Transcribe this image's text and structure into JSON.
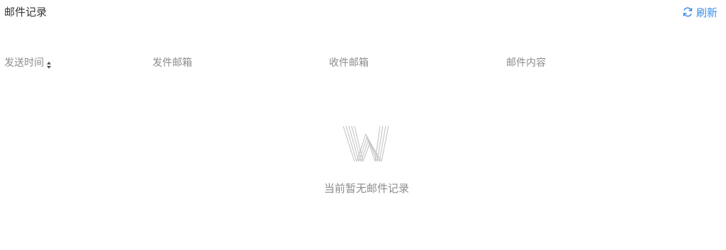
{
  "header": {
    "title": "邮件记录",
    "refresh_label": "刷新"
  },
  "table": {
    "columns": [
      {
        "label": "发送时间",
        "sortable": true
      },
      {
        "label": "发件邮箱",
        "sortable": false
      },
      {
        "label": "收件邮箱",
        "sortable": false
      },
      {
        "label": "邮件内容",
        "sortable": false
      }
    ],
    "rows": []
  },
  "empty_state": {
    "icon": "w-logo-icon",
    "message": "当前暂无邮件记录"
  },
  "colors": {
    "accent": "#3a8ee6",
    "muted_text": "#8c8c8c",
    "title_text": "#333333"
  }
}
